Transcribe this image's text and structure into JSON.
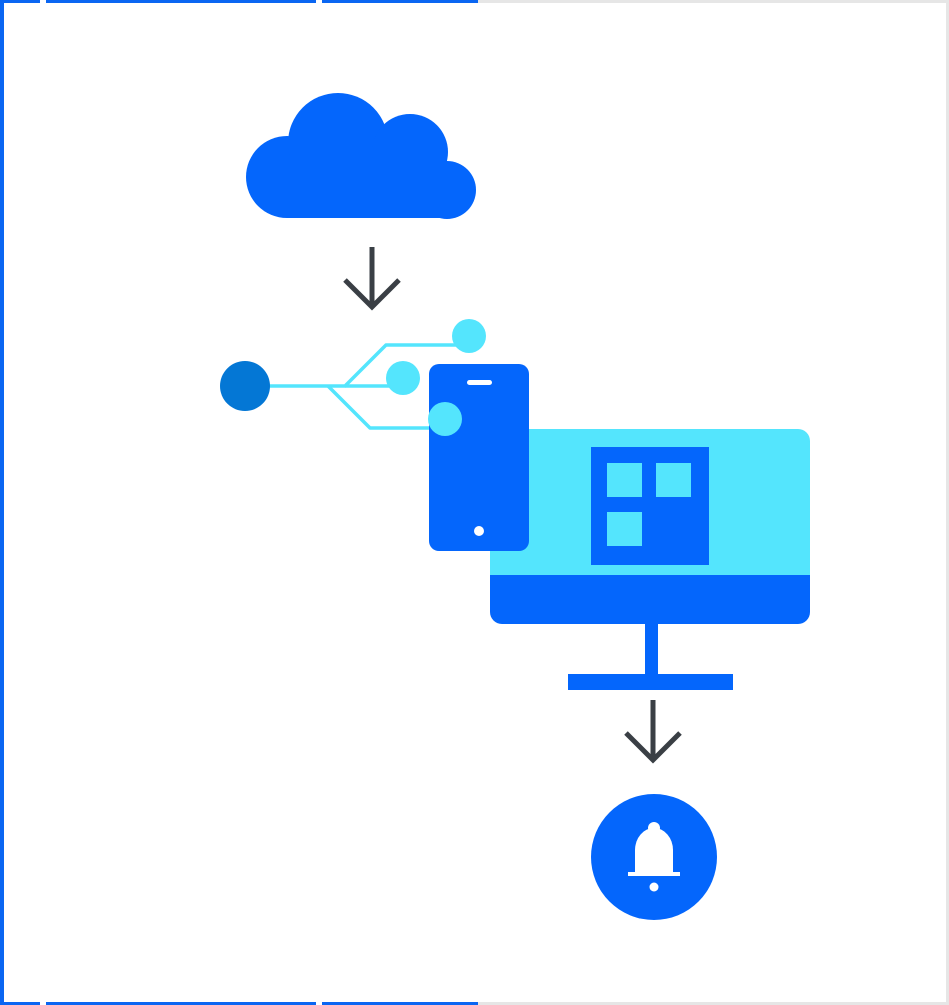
{
  "colors": {
    "background": "#ffffff",
    "frame_blue": "#0a66f2",
    "frame_gray": "#e6e6e6",
    "primary_blue": "#0466fc",
    "node_blue": "#0477d5",
    "light_cyan": "#54e5fd",
    "arrow_dark": "#3a3f45",
    "white": "#ffffff"
  },
  "icons": {
    "cloud": "cloud-icon",
    "arrow_down_top": "arrow-down-icon",
    "network": "network-branch-icon",
    "phone": "smartphone-icon",
    "monitor": "desktop-monitor-icon",
    "app_grid": "app-grid-icon",
    "arrow_down_bottom": "arrow-down-icon",
    "notification": "bell-icon"
  }
}
